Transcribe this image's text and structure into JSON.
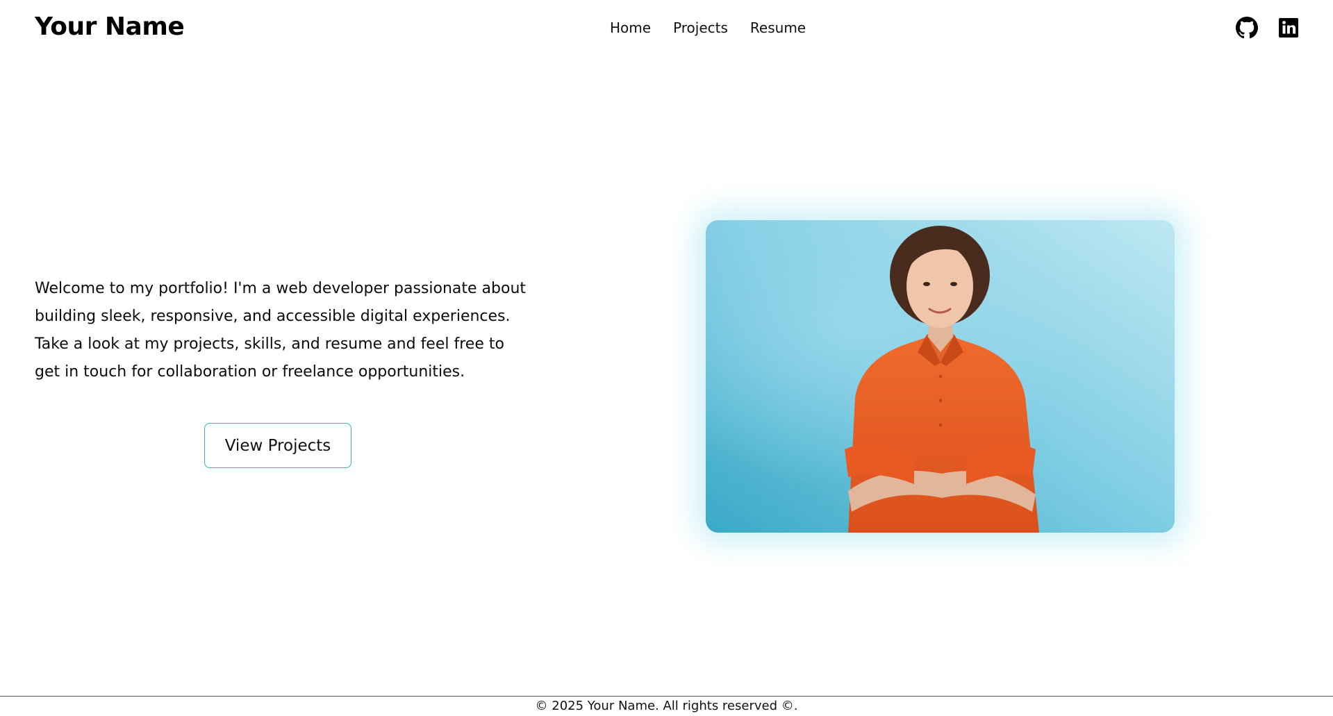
{
  "header": {
    "brand": "Your Name",
    "nav": [
      "Home",
      "Projects",
      "Resume"
    ],
    "social": [
      {
        "icon": "github-icon"
      },
      {
        "icon": "linkedin-icon"
      }
    ]
  },
  "hero": {
    "intro": "Welcome to my portfolio! I'm a web developer passionate about building sleek, responsive, and accessible digital experiences. Take a look at my projects, skills, and resume and feel free to get in touch for collaboration or freelance opportunities.",
    "cta_label": "View Projects",
    "photo": {
      "subject": "portrait-photo"
    }
  },
  "footer": {
    "text": "© 2025 Your Name. All rights reserved ©."
  },
  "colors": {
    "accent": "#2bb7c8",
    "photo_background": "#8fd4e6",
    "shirt": "#e85a22"
  }
}
